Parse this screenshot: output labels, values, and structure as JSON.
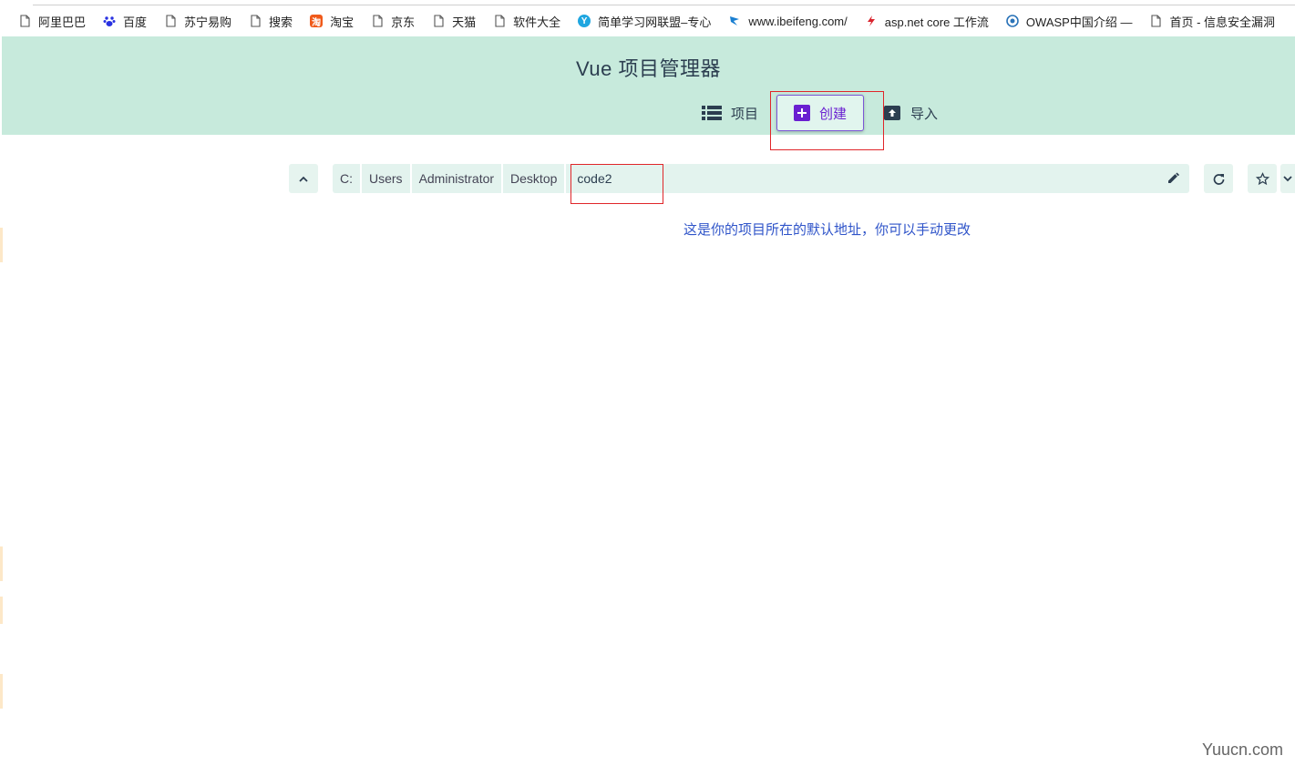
{
  "bookmarks": [
    {
      "label": "阿里巴巴",
      "icon": "page-icon"
    },
    {
      "label": "百度",
      "icon": "baidu-paw-icon"
    },
    {
      "label": "苏宁易购",
      "icon": "page-icon"
    },
    {
      "label": "搜索",
      "icon": "page-icon"
    },
    {
      "label": "淘宝",
      "icon": "taobao-icon"
    },
    {
      "label": "京东",
      "icon": "page-icon"
    },
    {
      "label": "天猫",
      "icon": "page-icon"
    },
    {
      "label": "软件大全",
      "icon": "page-icon"
    },
    {
      "label": "简单学习网联盟–专心",
      "icon": "y-badge-icon"
    },
    {
      "label": "www.ibeifeng.com/",
      "icon": "ibeifeng-icon"
    },
    {
      "label": "asp.net core 工作流",
      "icon": "aspnet-icon"
    },
    {
      "label": "OWASP中国介绍 —",
      "icon": "owasp-icon"
    },
    {
      "label": "首页 - 信息安全漏洞",
      "icon": "page-icon"
    }
  ],
  "header": {
    "title": "Vue 项目管理器",
    "nav": {
      "projects": "项目",
      "create": "创建",
      "import": "导入"
    }
  },
  "folder": {
    "crumbs": [
      "C:",
      "Users",
      "Administrator",
      "Desktop",
      "code2"
    ]
  },
  "hint": "这是你的项目所在的默认地址，你可以手动更改",
  "watermark": "Yuucn.com",
  "colors": {
    "header_bg": "#c7eadc",
    "accent_purple": "#6a1fd1",
    "annotation_red": "#e0262a",
    "hint_blue": "#2f54c9"
  }
}
